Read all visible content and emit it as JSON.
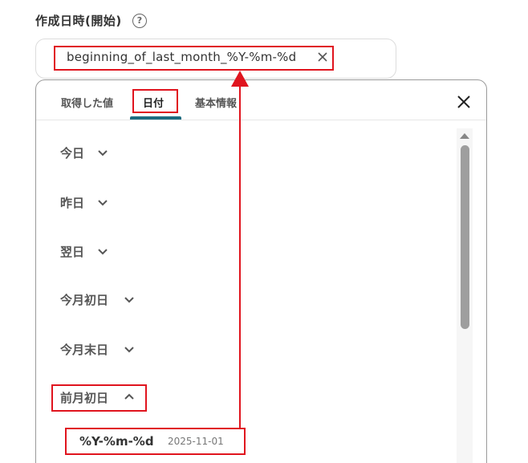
{
  "field": {
    "label": "作成日時(開始)",
    "help_icon": "?"
  },
  "input": {
    "value": "beginning_of_last_month_%Y-%m-%d"
  },
  "tabs": [
    {
      "label": "取得した値",
      "active": false
    },
    {
      "label": "日付",
      "active": true
    },
    {
      "label": "基本情報",
      "active": false
    }
  ],
  "groups": [
    {
      "label": "今日",
      "expanded": false
    },
    {
      "label": "昨日",
      "expanded": false
    },
    {
      "label": "翌日",
      "expanded": false
    },
    {
      "label": "今月初日",
      "expanded": false
    },
    {
      "label": "今月末日",
      "expanded": false
    },
    {
      "label": "前月初日",
      "expanded": true
    }
  ],
  "expanded_item": {
    "format": "%Y-%m-%d",
    "date": "2025-11-01"
  },
  "colors": {
    "highlight": "#e0141e",
    "tab_indicator": "#1c6c80",
    "scroll_thumb": "#9e9e9e"
  }
}
